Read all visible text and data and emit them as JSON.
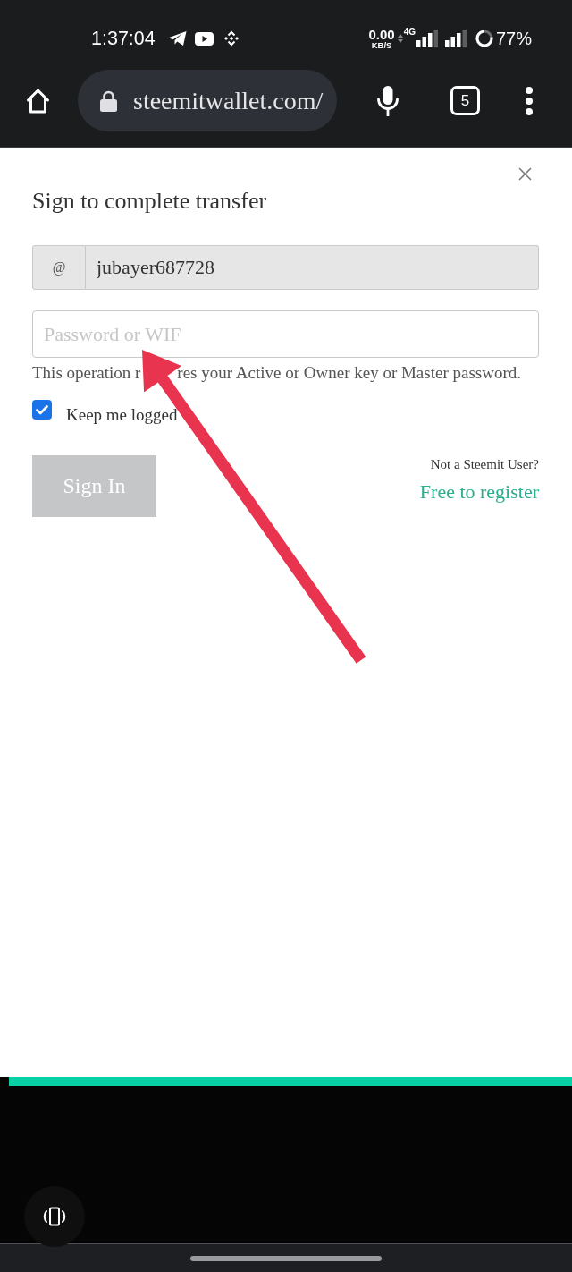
{
  "status_bar": {
    "time": "1:37:04",
    "net_speed": "0.00",
    "net_speed_unit": "KB/S",
    "network_type": "4G",
    "battery": "77%"
  },
  "browser_toolbar": {
    "url": "steemitwallet.com/",
    "tab_count": "5"
  },
  "dialog": {
    "title": "Sign to complete transfer",
    "username": {
      "prefix": "@",
      "value": "jubayer687728",
      "disabled": true
    },
    "password": {
      "placeholder": "Password or WIF"
    },
    "help_text_parts": [
      "This operation r",
      "res your Active or Owner key or Master password."
    ],
    "keep_logged": {
      "label": "Keep me logged",
      "checked": true
    },
    "sign_in_button": {
      "label": "Sign In",
      "disabled": true
    },
    "register_prompt": "Not a Steemit User?",
    "register_link": "Free to register"
  }
}
